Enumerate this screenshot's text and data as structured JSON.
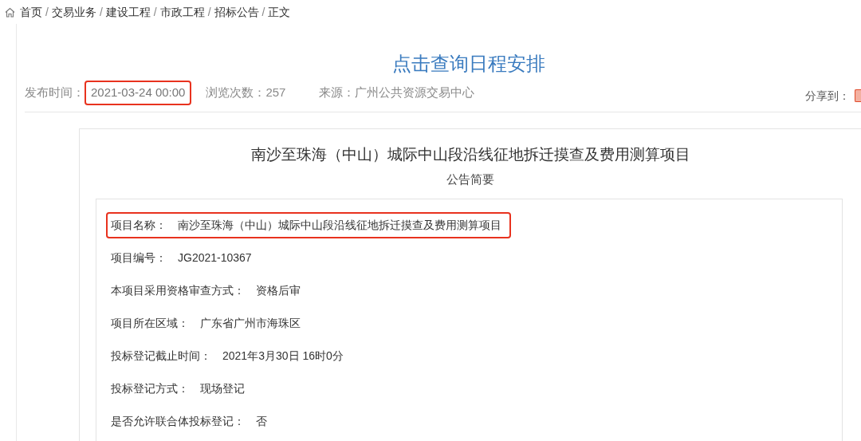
{
  "breadcrumb": [
    {
      "label": "首页"
    },
    {
      "label": "交易业务"
    },
    {
      "label": "建设工程"
    },
    {
      "label": "市政工程"
    },
    {
      "label": "招标公告"
    },
    {
      "label": "正文"
    }
  ],
  "breadcrumb_separator": "/",
  "schedule_link": "点击查询日程安排",
  "meta": {
    "publish_label": "发布时间：",
    "publish_value": "2021-03-24 00:00",
    "publish_highlighted": true,
    "views": "浏览次数：257",
    "source": "来源：广州公共资源交易中心",
    "share_label": "分享到："
  },
  "notice": {
    "title": "南沙至珠海（中山）城际中山段沿线征地拆迁摸查及费用测算项目",
    "subtitle": "公告简要",
    "fields": [
      {
        "label": "项目名称：",
        "value": "南沙至珠海（中山）城际中山段沿线征地拆迁摸查及费用测算项目",
        "highlighted": true
      },
      {
        "label": "项目编号：",
        "value": "JG2021-10367",
        "highlighted": false
      },
      {
        "label": "本项目采用资格审查方式：",
        "value": "资格后审",
        "highlighted": false
      },
      {
        "label": "项目所在区域：",
        "value": "广东省广州市海珠区",
        "highlighted": false
      },
      {
        "label": "投标登记截止时间：",
        "value": "2021年3月30日 16时0分",
        "highlighted": false
      },
      {
        "label": "投标登记方式：",
        "value": "现场登记",
        "highlighted": false
      },
      {
        "label": "是否允许联合体投标登记：",
        "value": "否",
        "highlighted": false
      }
    ]
  }
}
